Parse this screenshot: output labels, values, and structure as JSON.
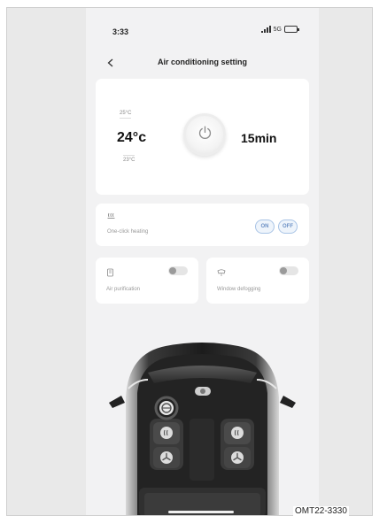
{
  "status_bar": {
    "time": "3:33",
    "network": "5G"
  },
  "nav": {
    "title": "Air conditioning setting"
  },
  "climate": {
    "temp_up": "25°C",
    "temperature": "24°c",
    "temp_down": "23°C",
    "timer": "15min"
  },
  "heating": {
    "label": "One-click heating",
    "on_label": "ON",
    "off_label": "OFF"
  },
  "features": [
    {
      "label": "Air purification",
      "icon": "air-purifier-icon",
      "enabled": false
    },
    {
      "label": "Window defogging",
      "icon": "defog-icon",
      "enabled": false
    }
  ],
  "figure_code": "OMT22-3330",
  "colors": {
    "accent": "#6b8fc4",
    "background": "#f2f2f3",
    "card": "#ffffff"
  }
}
